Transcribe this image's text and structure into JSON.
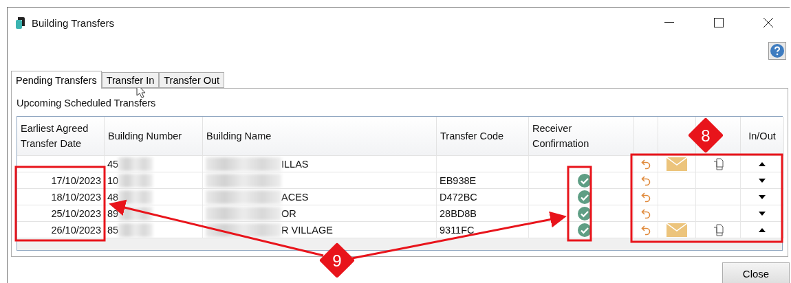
{
  "window": {
    "title": "Building Transfers"
  },
  "tabs": [
    {
      "label": "Pending Transfers",
      "selected": true
    },
    {
      "label": "Transfer In",
      "selected": false
    },
    {
      "label": "Transfer Out",
      "selected": false
    }
  ],
  "section_label": "Upcoming Scheduled Transfers",
  "table": {
    "columns": [
      "Earliest Agreed Transfer Date",
      "Building Number",
      "Building Name",
      "Transfer Code",
      "Receiver Confirmation",
      "In/Out"
    ],
    "rows": [
      {
        "number": {
          "text": "45",
          "blurred": true
        },
        "name": {
          "text": "ILLAS",
          "blurred": true
        },
        "confirmed": false,
        "undo": true,
        "mail": true,
        "copy": true,
        "incoming": true
      },
      {
        "date": "17/10/2023",
        "number": {
          "text": "10",
          "blurred": true
        },
        "name": {
          "blurred": true
        },
        "code": "EB938E",
        "confirmed": true,
        "undo": true,
        "mail": false,
        "copy": false,
        "incoming": false
      },
      {
        "date": "18/10/2023",
        "number": {
          "text": "48",
          "blurred": true
        },
        "name": {
          "text": "ACES",
          "blurred": true
        },
        "code": "D472BC",
        "confirmed": true,
        "undo": true,
        "mail": false,
        "copy": false,
        "incoming": false
      },
      {
        "date": "25/10/2023",
        "number": {
          "text": "89",
          "blurred": true
        },
        "name": {
          "text": "OR",
          "blurred": true
        },
        "code": "28BD8B",
        "confirmed": true,
        "undo": true,
        "mail": false,
        "copy": false,
        "incoming": false
      },
      {
        "date": "26/10/2023",
        "number": {
          "text": "85",
          "blurred": true
        },
        "name": {
          "text": "R VILLAGE",
          "blurred": true
        },
        "code": "9311FC",
        "confirmed": true,
        "undo": true,
        "mail": true,
        "copy": true,
        "incoming": true
      }
    ]
  },
  "annotations": [
    {
      "label": "8"
    },
    {
      "label": "9"
    }
  ],
  "buttons": [
    "Close"
  ]
}
